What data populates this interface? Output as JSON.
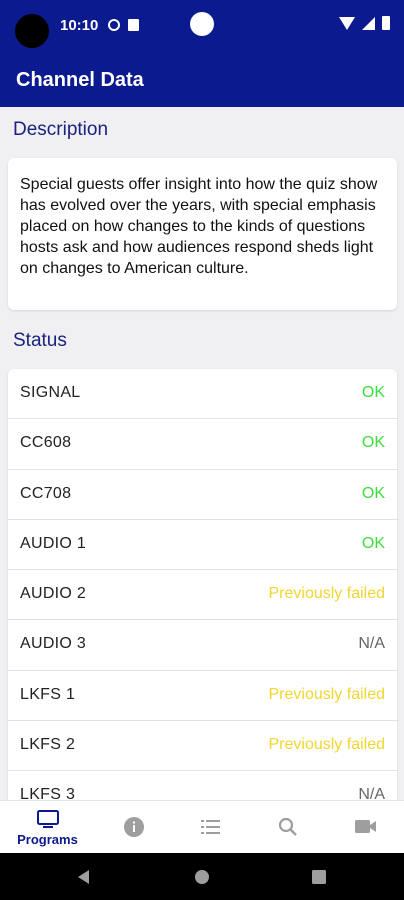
{
  "status_bar": {
    "time": "10:10"
  },
  "app_bar": {
    "title": "Channel Data"
  },
  "description": {
    "heading": "Description",
    "text": "Special guests offer insight into how the quiz show has evolved over the years, with special emphasis placed on how changes to the kinds of questions hosts ask and how audiences respond sheds light on changes to American culture."
  },
  "status": {
    "heading": "Status",
    "rows": [
      {
        "label": "SIGNAL",
        "value": "OK",
        "color": "#3ddc3d"
      },
      {
        "label": "CC608",
        "value": "OK",
        "color": "#3ddc3d"
      },
      {
        "label": "CC708",
        "value": "OK",
        "color": "#3ddc3d"
      },
      {
        "label": "AUDIO 1",
        "value": "OK",
        "color": "#3ddc3d"
      },
      {
        "label": "AUDIO 2",
        "value": "Previously failed",
        "color": "#f2d530"
      },
      {
        "label": "AUDIO 3",
        "value": "N/A",
        "color": "#666666"
      },
      {
        "label": "LKFS 1",
        "value": "Previously failed",
        "color": "#f2d530"
      },
      {
        "label": "LKFS 2",
        "value": "Previously failed",
        "color": "#f2d530"
      },
      {
        "label": "LKFS 3",
        "value": "N/A",
        "color": "#666666"
      }
    ]
  },
  "bottom_nav": {
    "items": [
      {
        "name": "programs",
        "label": "Programs",
        "icon": "tv-icon",
        "active": true
      },
      {
        "name": "info",
        "label": "",
        "icon": "info-icon",
        "active": false
      },
      {
        "name": "list",
        "label": "",
        "icon": "list-icon",
        "active": false
      },
      {
        "name": "search",
        "label": "",
        "icon": "search-icon",
        "active": false
      },
      {
        "name": "video",
        "label": "",
        "icon": "video-camera-icon",
        "active": false
      }
    ]
  },
  "colors": {
    "primary": "#0b1b8f",
    "ok": "#3ddc3d",
    "warning": "#f2d530",
    "na": "#666666"
  }
}
